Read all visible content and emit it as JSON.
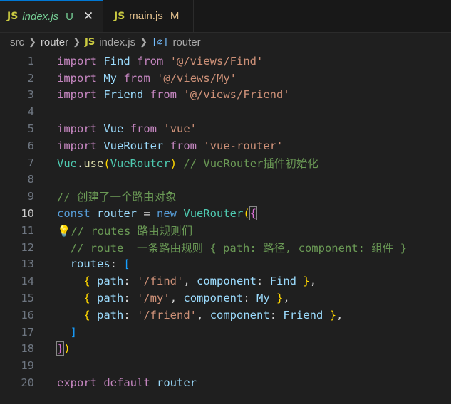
{
  "tabs": [
    {
      "badge": "JS",
      "name": "index.js",
      "status": "U",
      "close": "✕"
    },
    {
      "badge": "JS",
      "name": "main.js",
      "status": "M"
    }
  ],
  "breadcrumb": {
    "src": "src",
    "router": "router",
    "file_badge": "JS",
    "file": "index.js",
    "symbol_icon": "[∅]",
    "symbol": "router",
    "sep": "❯"
  },
  "lines": [
    "1",
    "2",
    "3",
    "4",
    "5",
    "6",
    "7",
    "8",
    "9",
    "10",
    "11",
    "12",
    "13",
    "14",
    "15",
    "16",
    "17",
    "18",
    "19",
    "20"
  ],
  "code": {
    "import": "import",
    "from": "from",
    "const": "const",
    "new": "new",
    "export": "export",
    "default": "default",
    "Find": "Find",
    "My": "My",
    "Friend": "Friend",
    "Vue": "Vue",
    "VueRouter": "VueRouter",
    "router": "router",
    "use": "use",
    "routes": "routes",
    "path": "path",
    "component": "component",
    "s_find": "'@/views/Find'",
    "s_my": "'@/views/My'",
    "s_friend": "'@/views/Friend'",
    "s_vue": "'vue'",
    "s_vuerouter": "'vue-router'",
    "s_p_find": "'/find'",
    "s_p_my": "'/my'",
    "s_p_friend": "'/friend'",
    "c7": "// VueRouter插件初始化",
    "c9": "// 创建了一个路由对象",
    "c11": "// routes 路由规则们",
    "c12": "// route  一条路由规则 { path: 路径, component: 组件 }",
    "lightbulb": "💡"
  }
}
